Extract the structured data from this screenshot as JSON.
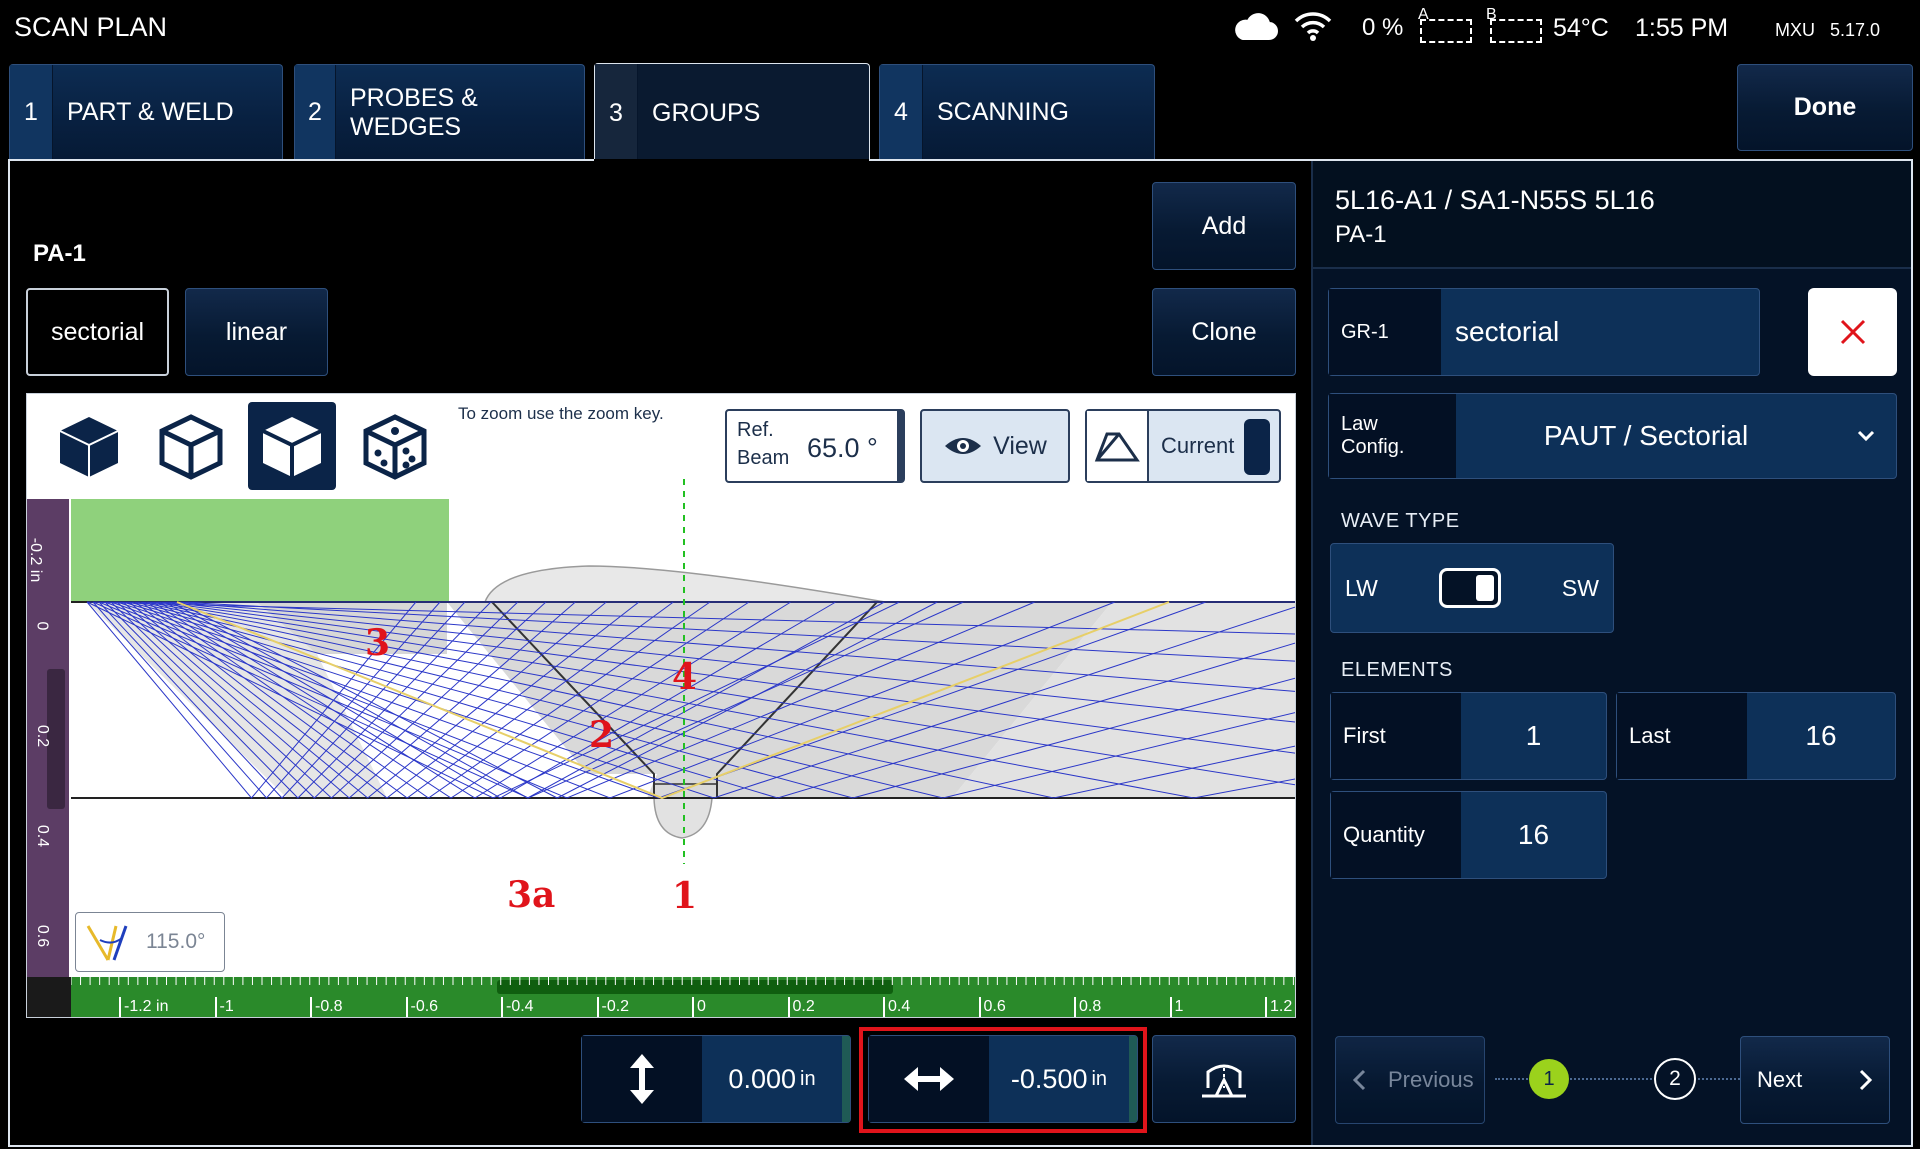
{
  "header": {
    "title": "SCAN PLAN",
    "battery": "0 %",
    "slot_a": "A",
    "slot_b": "B",
    "temperature": "54°C",
    "time": "1:55 PM",
    "device": "MXU",
    "version": "5.17.0"
  },
  "tabs": [
    {
      "num": "1",
      "label": "PART & WELD"
    },
    {
      "num": "2",
      "label": "PROBES & WEDGES"
    },
    {
      "num": "3",
      "label": "GROUPS"
    },
    {
      "num": "4",
      "label": "SCANNING"
    }
  ],
  "done_label": "Done",
  "left": {
    "group_name": "PA-1",
    "type_sectorial": "sectorial",
    "type_linear": "linear",
    "add_label": "Add",
    "clone_label": "Clone",
    "zoom_hint": "To zoom use the zoom key.",
    "ref_beam_label_1": "Ref.",
    "ref_beam_label_2": "Beam",
    "ref_beam_value": "65.0 °",
    "view_label": "View",
    "current_label": "Current",
    "angle_badge": "115.0°",
    "vertical_offset": "0.000",
    "vertical_unit": "in",
    "horizontal_offset": "-0.500",
    "horizontal_unit": "in",
    "ruler_x": [
      "-1.2 in",
      "-1",
      "-0.8",
      "-0.6",
      "-0.4",
      "-0.2",
      "0",
      "0.2",
      "0.4",
      "0.6",
      "0.8",
      "1",
      "1.2"
    ],
    "ruler_y": [
      "-0.2 in",
      "0",
      "0.2",
      "0.4",
      "0.6"
    ],
    "annotations": [
      "3",
      "4",
      "2",
      "3a",
      "1"
    ]
  },
  "right": {
    "probe_line1": "5L16-A1 / SA1-N55S 5L16",
    "probe_line2": "PA-1",
    "group_id": "GR-1",
    "group_type": "sectorial",
    "law_config_label_1": "Law",
    "law_config_label_2": "Config.",
    "law_config_value": "PAUT / Sectorial",
    "wave_type_title": "WAVE TYPE",
    "wave_lw": "LW",
    "wave_sw": "SW",
    "elements_title": "ELEMENTS",
    "first_label": "First",
    "first_value": "1",
    "last_label": "Last",
    "last_value": "16",
    "quantity_label": "Quantity",
    "quantity_value": "16",
    "previous_label": "Previous",
    "next_label": "Next",
    "step1": "1",
    "step2": "2"
  },
  "colors": {
    "accent_red": "#e0141b",
    "step_active": "#9bd21c",
    "beam_blue": "#2b37c8",
    "part_green": "#8fd17c"
  }
}
